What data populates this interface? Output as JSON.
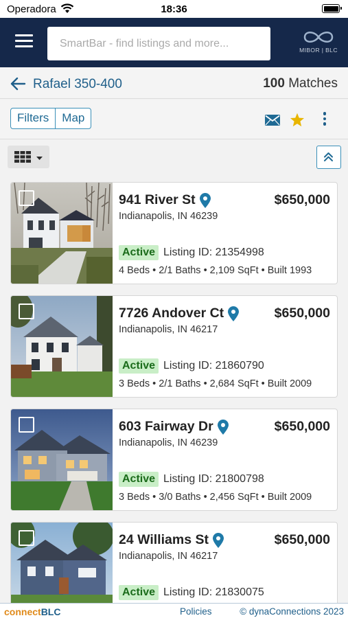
{
  "status_bar": {
    "carrier": "Operadora",
    "time": "18:36"
  },
  "header": {
    "search_placeholder": "SmartBar - find listings and more...",
    "logo_text": "MIBOR | BLC"
  },
  "titlebar": {
    "search_name": "Rafael 350-400",
    "match_count": "100",
    "match_label": "Matches"
  },
  "toolbar": {
    "filters_label": "Filters",
    "map_label": "Map"
  },
  "colors": {
    "header_bg": "#15284a",
    "accent": "#1f5f8a",
    "active_bg": "#c9eec7",
    "star": "#e8b500"
  },
  "listings": [
    {
      "address": "941 River St",
      "price": "$650,000",
      "city": "Indianapolis, IN 46239",
      "status": "Active",
      "listing_id": "Listing ID: 21354998",
      "details": "4 Beds • 2/1 Baths • 2,109 SqFt • Built 1993"
    },
    {
      "address": "7726 Andover Ct",
      "price": "$650,000",
      "city": "Indianapolis, IN 46217",
      "status": "Active",
      "listing_id": "Listing ID: 21860790",
      "details": "3 Beds • 2/1 Baths • 2,684 SqFt • Built 2009"
    },
    {
      "address": "603 Fairway Dr",
      "price": "$650,000",
      "city": "Indianapolis, IN 46239",
      "status": "Active",
      "listing_id": "Listing ID: 21800798",
      "details": "3 Beds • 3/0 Baths • 2,456 SqFt • Built 2009"
    },
    {
      "address": "24 Williams St",
      "price": "$650,000",
      "city": "Indianapolis, IN 46217",
      "status": "Active",
      "listing_id": "Listing ID: 21830075",
      "details": ""
    }
  ],
  "footer": {
    "brand_part1": "connect",
    "brand_part2": "BLC",
    "policies": "Policies",
    "copyright": "© dynaConnections 2023"
  }
}
